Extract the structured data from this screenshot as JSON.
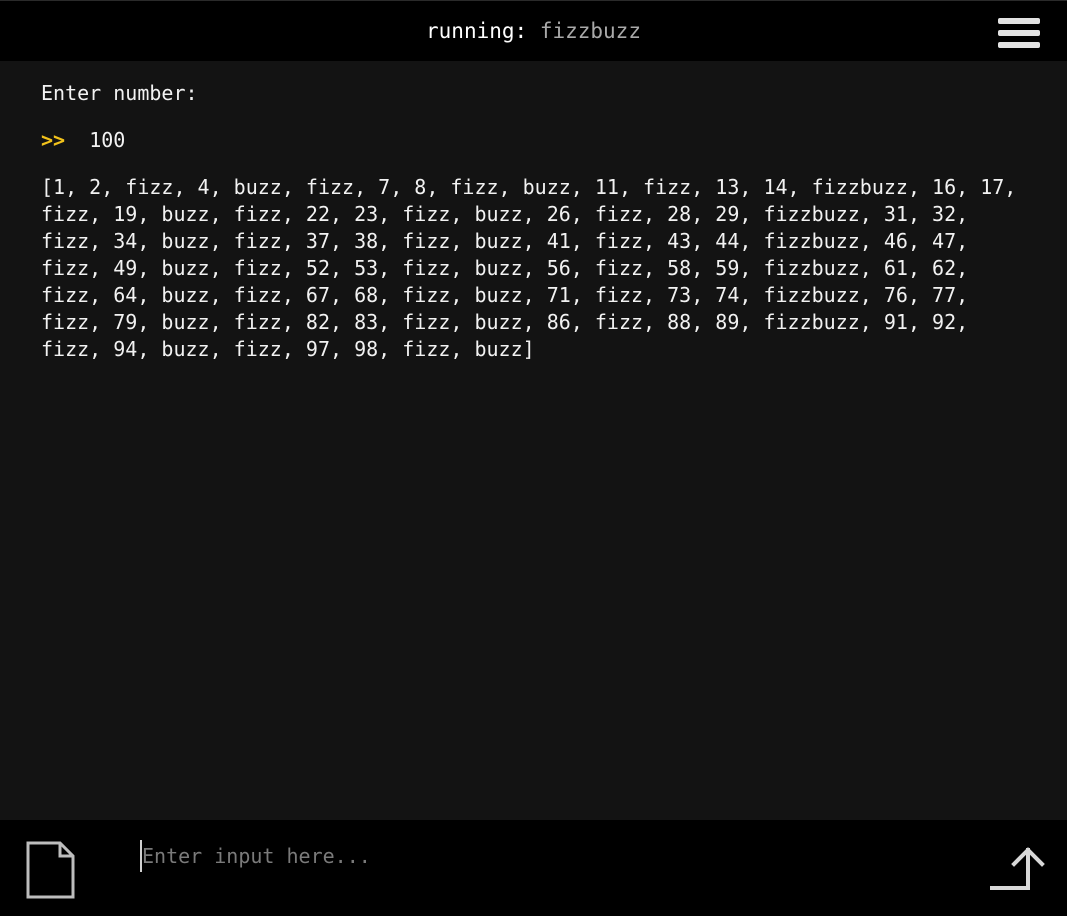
{
  "header": {
    "prefix": "running: ",
    "program": "fizzbuzz",
    "menu_icon": "hamburger-menu-icon"
  },
  "console": {
    "prompt_text": "Enter number:",
    "input_marker": ">>",
    "user_input": "100",
    "output": "[1, 2, fizz, 4, buzz, fizz, 7, 8, fizz, buzz, 11, fizz, 13, 14, fizzbuzz, 16, 17, fizz, 19, buzz, fizz, 22, 23, fizz, buzz, 26, fizz, 28, 29, fizzbuzz, 31, 32, fizz, 34, buzz, fizz, 37, 38, fizz, buzz, 41, fizz, 43, 44, fizzbuzz, 46, 47, fizz, 49, buzz, fizz, 52, 53, fizz, buzz, 56, fizz, 58, 59, fizzbuzz, 61, 62, fizz, 64, buzz, fizz, 67, 68, fizz, buzz, 71, fizz, 73, 74, fizzbuzz, 76, 77, fizz, 79, buzz, fizz, 82, 83, fizz, buzz, 86, fizz, 88, 89, fizzbuzz, 91, 92, fizz, 94, buzz, fizz, 97, 98, fizz, buzz]"
  },
  "footer": {
    "file_icon": "file-icon",
    "input_placeholder": "Enter input here...",
    "input_value": "",
    "send_icon": "send-arrow-icon"
  },
  "colors": {
    "background": "#131313",
    "bar_background": "#000000",
    "accent_marker": "#f2c21b",
    "text": "#f2f2f2",
    "muted_text": "#a9a9a9"
  }
}
